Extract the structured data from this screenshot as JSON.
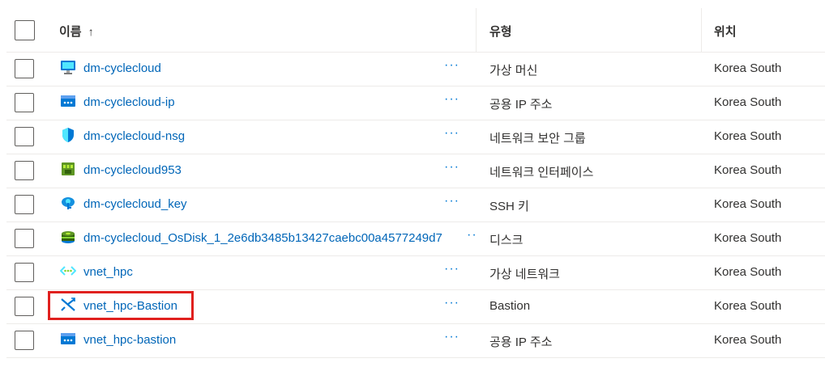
{
  "header": {
    "name_label": "이름",
    "sort_arrow": "↑",
    "type_label": "유형",
    "location_label": "위치"
  },
  "rows": [
    {
      "icon": "virtual-machine-icon",
      "name": "dm-cyclecloud",
      "more": "···",
      "type": "가상 머신",
      "location": "Korea South"
    },
    {
      "icon": "public-ip-icon",
      "name": "dm-cyclecloud-ip",
      "more": "···",
      "type": "공용 IP 주소",
      "location": "Korea South"
    },
    {
      "icon": "nsg-shield-icon",
      "name": "dm-cyclecloud-nsg",
      "more": "···",
      "type": "네트워크 보안 그룹",
      "location": "Korea South"
    },
    {
      "icon": "network-interface-icon",
      "name": "dm-cyclecloud953",
      "more": "···",
      "type": "네트워크 인터페이스",
      "location": "Korea South"
    },
    {
      "icon": "ssh-key-icon",
      "name": "dm-cyclecloud_key",
      "more": "···",
      "type": "SSH 키",
      "location": "Korea South"
    },
    {
      "icon": "disk-icon",
      "name": "dm-cyclecloud_OsDisk_1_2e6db3485b13427caebc00a4577249d7",
      "more": "··",
      "type": "디스크",
      "location": "Korea South"
    },
    {
      "icon": "virtual-network-icon",
      "name": "vnet_hpc",
      "more": "···",
      "type": "가상 네트워크",
      "location": "Korea South"
    },
    {
      "icon": "bastion-icon",
      "name": "vnet_hpc-Bastion",
      "more": "···",
      "type": "Bastion",
      "location": "Korea South"
    },
    {
      "icon": "public-ip-icon",
      "name": "vnet_hpc-bastion",
      "more": "···",
      "type": "공용 IP 주소",
      "location": "Korea South"
    }
  ]
}
